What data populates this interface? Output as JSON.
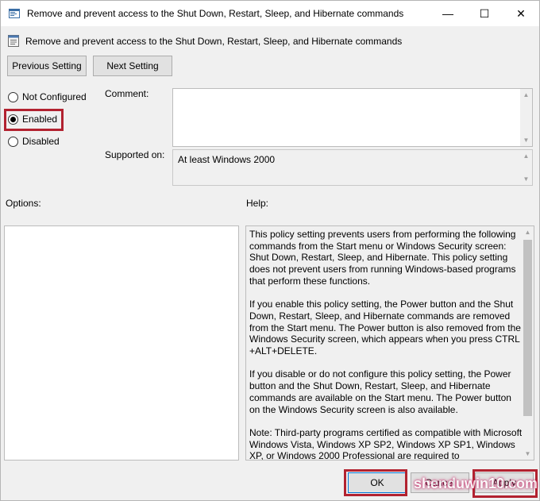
{
  "window": {
    "title": "Remove and prevent access to the Shut Down, Restart, Sleep, and Hibernate commands",
    "controls": {
      "minimize": "—",
      "maximize": "☐",
      "close": "✕"
    }
  },
  "header": {
    "policy_title": "Remove and prevent access to the Shut Down, Restart, Sleep, and Hibernate commands",
    "icon": "policy-setting-icon"
  },
  "nav": {
    "previous_label": "Previous Setting",
    "next_label": "Next Setting"
  },
  "state": {
    "selected": "Enabled",
    "options": [
      {
        "label": "Not Configured",
        "selected": false
      },
      {
        "label": "Enabled",
        "selected": true
      },
      {
        "label": "Disabled",
        "selected": false
      }
    ]
  },
  "comment": {
    "label": "Comment:",
    "value": ""
  },
  "supported_on": {
    "label": "Supported on:",
    "value": "At least Windows 2000"
  },
  "options": {
    "label": "Options:"
  },
  "help": {
    "label": "Help:",
    "paragraphs": [
      "This policy setting prevents users from performing the following commands from the Start menu or Windows Security screen: Shut Down, Restart, Sleep, and Hibernate. This policy setting does not prevent users from running Windows-based programs that perform these functions.",
      "If you enable this policy setting, the Power button and the Shut Down, Restart, Sleep, and Hibernate commands are removed from the Start menu. The Power button is also removed from the Windows Security screen, which appears when you press CTRL +ALT+DELETE.",
      "If you disable or do not configure this policy setting, the Power button and the Shut Down, Restart, Sleep, and Hibernate commands are available on the Start menu. The Power button on the Windows Security screen is also available.",
      "Note: Third-party programs certified as compatible with Microsoft Windows Vista, Windows XP SP2, Windows XP SP1, Windows XP, or Windows 2000 Professional are required to"
    ]
  },
  "footer": {
    "ok_label": "OK",
    "cancel_label": "Cancel",
    "apply_label": "Apply"
  },
  "watermark": "shenduwin10.com",
  "colors": {
    "highlight": "#b22230",
    "default_button_border": "#0078d7"
  }
}
